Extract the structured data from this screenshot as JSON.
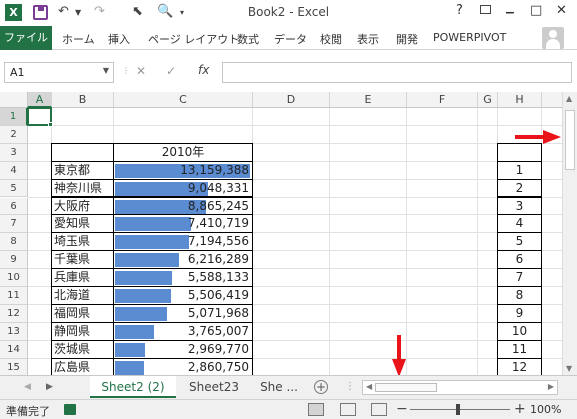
{
  "window": {
    "title": "Book2 - Excel",
    "excel_logo": "X",
    "help": "?",
    "minimize": "▁",
    "restore": "□",
    "close": "✕"
  },
  "quick_access": {
    "save_icon": "save-icon",
    "undo_icon": "undo-icon",
    "redo_icon": "redo-icon",
    "pointer_icon": "pointer-icon",
    "print_preview_icon": "print-preview-icon"
  },
  "ribbon": {
    "file": "ファイル",
    "tabs": [
      "ホーム",
      "挿入",
      "ページ レイアウト",
      "数式",
      "データ",
      "校閲",
      "表示",
      "開発",
      "POWERPIVOT"
    ]
  },
  "formula_bar": {
    "name_box": "A1",
    "cancel": "✕",
    "enter": "✓",
    "fx": "fx",
    "formula": ""
  },
  "sheet": {
    "columns": [
      "A",
      "B",
      "C",
      "D",
      "E",
      "F",
      "G",
      "H"
    ],
    "rows": [
      "1",
      "2",
      "3",
      "4",
      "5",
      "6",
      "7",
      "8",
      "9",
      "10",
      "11",
      "12",
      "13",
      "14",
      "15"
    ],
    "selected_cell": "A1",
    "table_header": "2010年",
    "prefectures": [
      "東京都",
      "神奈川県",
      "大阪府",
      "愛知県",
      "埼玉県",
      "千葉県",
      "兵庫県",
      "北海道",
      "福岡県",
      "静岡県",
      "茨城県",
      "広島県"
    ],
    "values_display": [
      "13,159,388",
      "9,048,331",
      "8,865,245",
      "7,410,719",
      "7,194,556",
      "6,216,289",
      "5,588,133",
      "5,506,419",
      "5,071,968",
      "3,765,007",
      "2,969,770",
      "2,860,750"
    ],
    "values": [
      13159388,
      9048331,
      8865245,
      7410719,
      7194556,
      6216289,
      5588133,
      5506419,
      5071968,
      3765007,
      2969770,
      2860750
    ],
    "data_bar_color": "#5b8bd0",
    "rank_numbers": [
      "1",
      "2",
      "3",
      "4",
      "5",
      "6",
      "7",
      "8",
      "9",
      "10",
      "11",
      "12"
    ]
  },
  "sheet_tabs": {
    "tabs": [
      "Sheet2 (2)",
      "Sheet23",
      "She ..."
    ],
    "active": "Sheet2 (2)",
    "add": "+",
    "nav_left": "◀",
    "nav_right": "▶"
  },
  "status_bar": {
    "status": "準備完了",
    "zoom_minus": "−",
    "zoom_plus": "+",
    "zoom": "100%"
  },
  "accent_color": "#217346",
  "annotation_color": "#e8141a"
}
